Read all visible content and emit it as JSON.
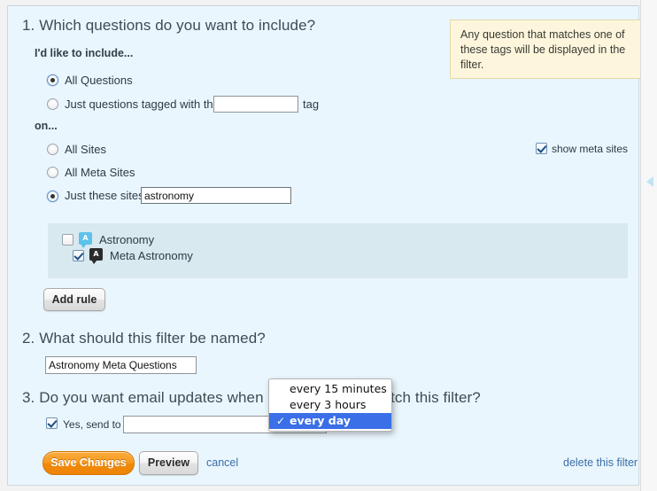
{
  "sections": {
    "q1": {
      "title": "1. Which questions do you want to include?",
      "include_label": "I'd like to include...",
      "opt_all_questions": "All Questions",
      "opt_tagged_prefix": "Just questions tagged with the",
      "opt_tagged_suffix": "tag",
      "tag_input_value": "",
      "on_label": "on...",
      "opt_all_sites": "All Sites",
      "opt_all_meta_sites": "All Meta Sites",
      "opt_just_these_sites": "Just these sites",
      "sites_input_value": "astronomy",
      "show_meta_sites_label": "show meta sites",
      "add_rule_label": "Add rule",
      "site_list": [
        {
          "name": "Astronomy",
          "icon_letter": "A",
          "checked": false,
          "icon_kind": "astro"
        },
        {
          "name": "Meta Astronomy",
          "icon_letter": "A",
          "checked": true,
          "icon_kind": "meta"
        }
      ]
    },
    "q2": {
      "title": "2. What should this filter be named?",
      "name_input_value": "Astronomy Meta Questions"
    },
    "q3": {
      "title": "3. Do you want email updates when new questions match this filter?",
      "yes_label": "Yes, send to",
      "email_input_value": "",
      "email_placeholder": ""
    }
  },
  "tooltip": {
    "text": "Any question that matches one of these tags will be displayed in the filter."
  },
  "frequency_dropdown": {
    "options": [
      {
        "label": "every 15 minutes",
        "selected": false
      },
      {
        "label": "every 3 hours",
        "selected": false
      },
      {
        "label": "every day",
        "selected": true
      }
    ],
    "check_glyph": "✓"
  },
  "footer": {
    "save_label": "Save Changes",
    "preview_label": "Preview",
    "cancel_label": "cancel",
    "delete_label": "delete this filter"
  },
  "colors": {
    "panel_bg": "#eaf6fd",
    "site_list_bg": "#d8e9ef",
    "tooltip_bg": "#fdf6dd",
    "accent_orange": "#f79a20",
    "selection_blue": "#3b6fe8",
    "link_blue": "#3b6ea8",
    "astro_icon": "#5ec2ea",
    "meta_icon": "#2b2b2b"
  }
}
